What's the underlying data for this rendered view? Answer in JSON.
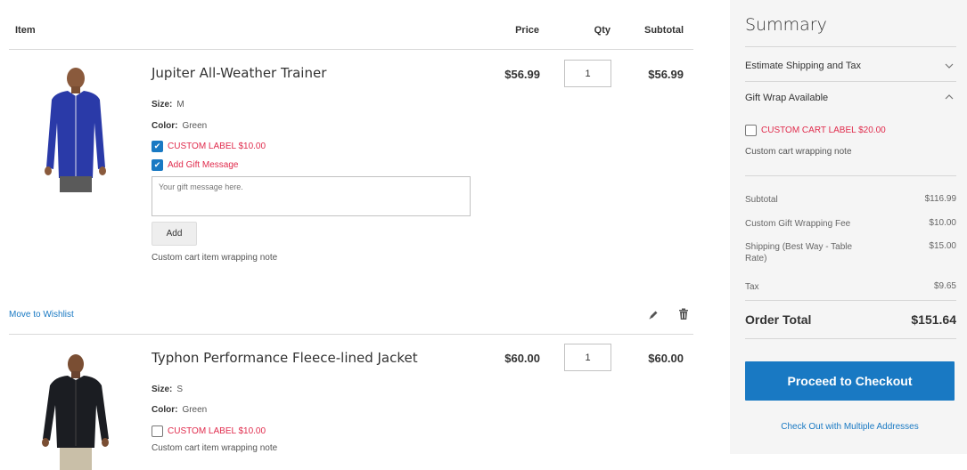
{
  "cart": {
    "headers": {
      "item": "Item",
      "price": "Price",
      "qty": "Qty",
      "subtotal": "Subtotal"
    },
    "items": [
      {
        "name": "Jupiter All-Weather Trainer",
        "price": "$56.99",
        "qty": "1",
        "subtotal": "$56.99",
        "size_label": "Size:",
        "size_value": "M",
        "color_label": "Color:",
        "color_value": "Green",
        "custom_label": "CUSTOM LABEL $10.00",
        "custom_label_checked": true,
        "gift_message_label": "Add Gift Message",
        "gift_message_checked": true,
        "gift_message_placeholder": "Your gift message here.",
        "add_button": "Add",
        "wrapping_note": "Custom cart item wrapping note",
        "move_to_wishlist": "Move to Wishlist",
        "shirt_color": "#2a3aa8"
      },
      {
        "name": "Typhon Performance Fleece-lined Jacket",
        "price": "$60.00",
        "qty": "1",
        "subtotal": "$60.00",
        "size_label": "Size:",
        "size_value": "S",
        "color_label": "Color:",
        "color_value": "Green",
        "custom_label": "CUSTOM LABEL $10.00",
        "custom_label_checked": false,
        "wrapping_note": "Custom cart item wrapping note",
        "shirt_color": "#1b1d22"
      }
    ]
  },
  "summary": {
    "title": "Summary",
    "estimate_shipping": "Estimate Shipping and Tax",
    "gift_wrap": "Gift Wrap Available",
    "custom_cart_label": "CUSTOM CART LABEL $20.00",
    "cart_wrapping_note": "Custom cart wrapping note",
    "totals": [
      {
        "label": "Subtotal",
        "value": "$116.99"
      },
      {
        "label": "Custom Gift Wrapping Fee",
        "value": "$10.00"
      },
      {
        "label": "Shipping (Best Way - Table Rate)",
        "value": "$15.00"
      },
      {
        "label": "Tax",
        "value": "$9.65"
      }
    ],
    "order_total_label": "Order Total",
    "order_total_value": "$151.64",
    "checkout_button": "Proceed to Checkout",
    "multi_address_link": "Check Out with Multiple Addresses"
  },
  "colors": {
    "accent_blue": "#1979c3",
    "label_red": "#e02b4c",
    "summary_bg": "#f5f5f5"
  },
  "icons": [
    "pencil-icon",
    "trash-icon",
    "chevron-down-icon",
    "chevron-up-icon",
    "checkmark-icon"
  ]
}
